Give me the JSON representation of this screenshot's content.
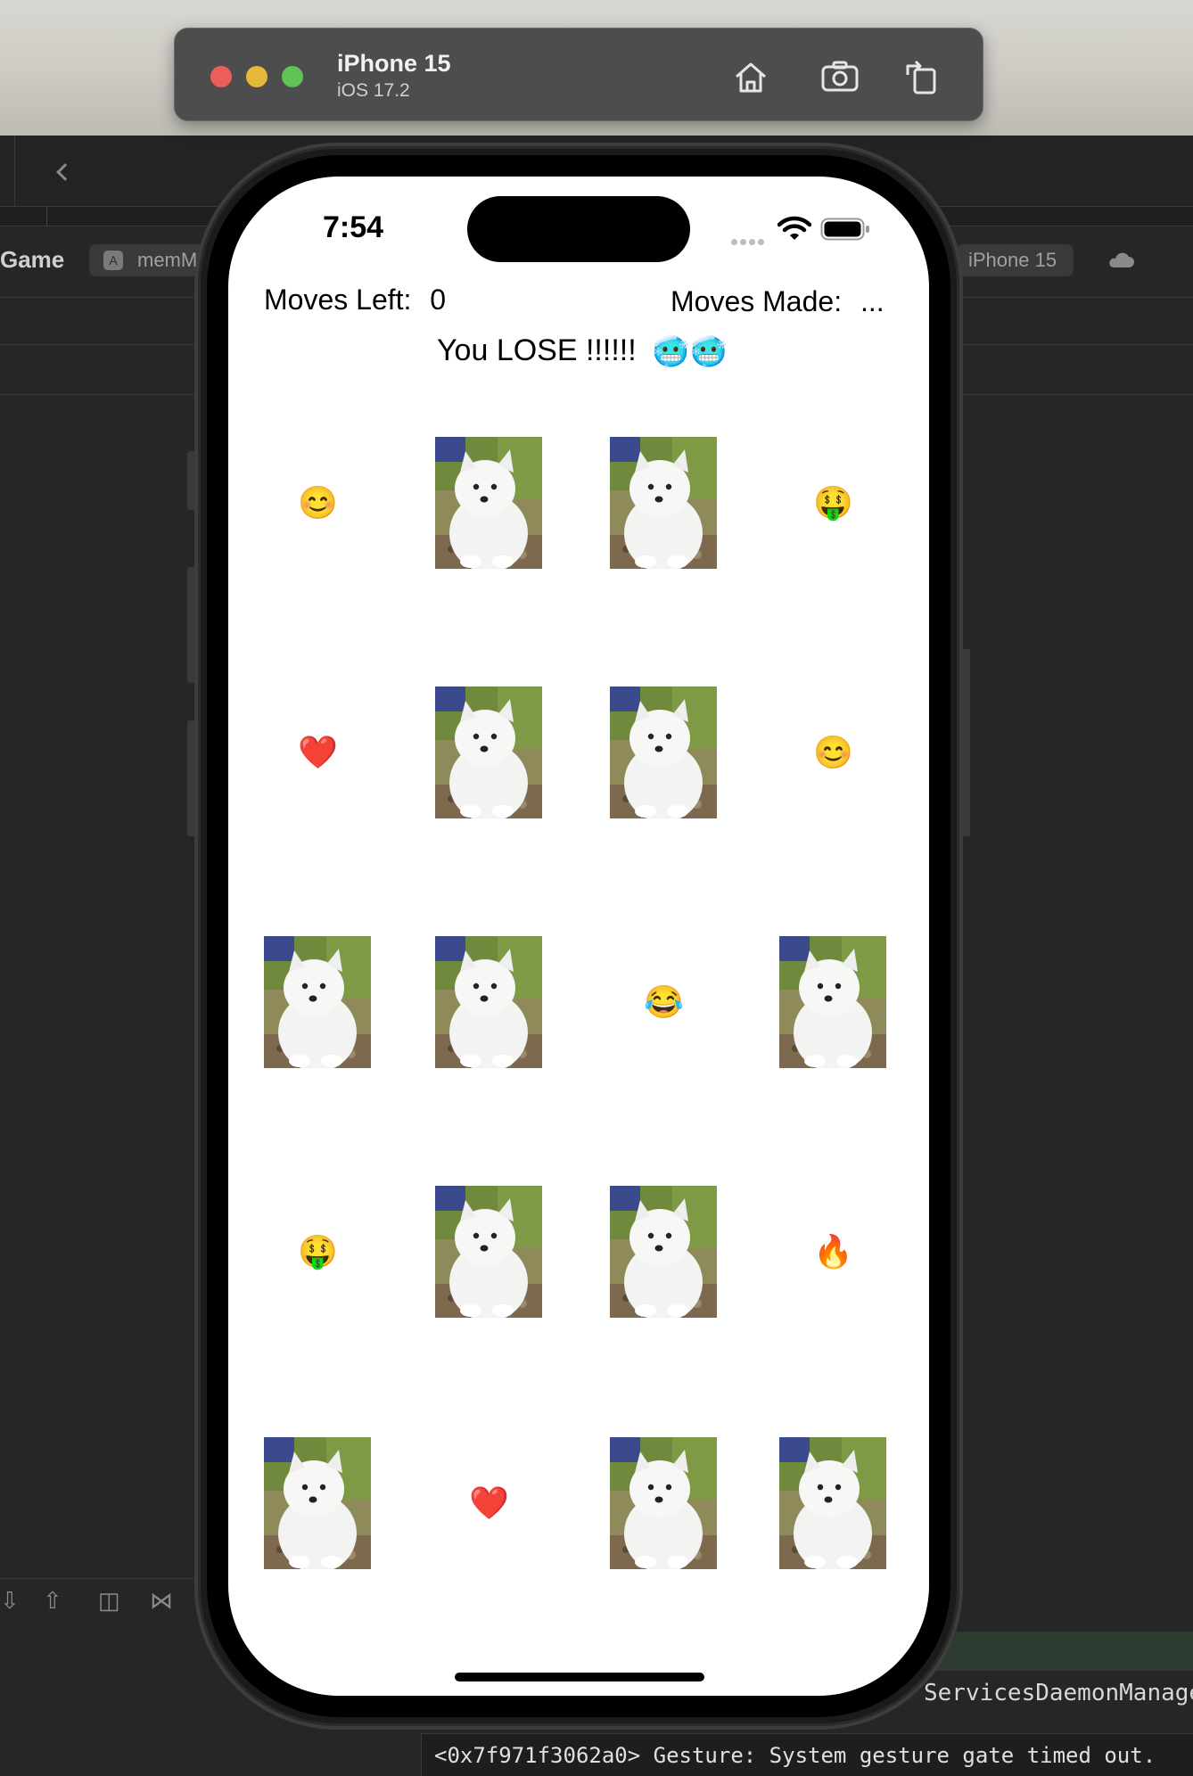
{
  "simulator": {
    "device_name": "iPhone 15",
    "os_version": "iOS 17.2",
    "buttons": [
      {
        "name": "home-icon"
      },
      {
        "name": "screenshot-icon"
      },
      {
        "name": "rotate-icon"
      }
    ]
  },
  "xcode": {
    "project_label": "Game",
    "scheme_label": "memM",
    "run_destination": "iPhone 15",
    "console_partial": "ServicesDaemonManager",
    "console_log": "<0x7f971f3062a0> Gesture: System gesture gate timed out."
  },
  "status_bar": {
    "time": "7:54"
  },
  "game": {
    "moves_left_label": "Moves Left:",
    "moves_left_value": "0",
    "moves_made_label": "Moves Made:",
    "moves_made_value": "...",
    "result_text": "You LOSE !!!!!!",
    "result_emoji": "🥶🥶",
    "board": [
      {
        "type": "emoji",
        "symbol": "😊"
      },
      {
        "type": "photo",
        "subject": "white puppy"
      },
      {
        "type": "photo",
        "subject": "white puppy"
      },
      {
        "type": "emoji",
        "symbol": "🤑"
      },
      {
        "type": "emoji",
        "symbol": "❤️"
      },
      {
        "type": "photo",
        "subject": "white puppy"
      },
      {
        "type": "photo",
        "subject": "white puppy"
      },
      {
        "type": "emoji",
        "symbol": "😊"
      },
      {
        "type": "photo",
        "subject": "white puppy"
      },
      {
        "type": "photo",
        "subject": "white puppy"
      },
      {
        "type": "emoji",
        "symbol": "😂"
      },
      {
        "type": "photo",
        "subject": "white puppy"
      },
      {
        "type": "emoji",
        "symbol": "🤑"
      },
      {
        "type": "photo",
        "subject": "white puppy"
      },
      {
        "type": "photo",
        "subject": "white puppy"
      },
      {
        "type": "emoji",
        "symbol": "🔥"
      },
      {
        "type": "photo",
        "subject": "white puppy"
      },
      {
        "type": "emoji",
        "symbol": "❤️"
      },
      {
        "type": "photo",
        "subject": "white puppy"
      },
      {
        "type": "photo",
        "subject": "white puppy"
      }
    ]
  }
}
